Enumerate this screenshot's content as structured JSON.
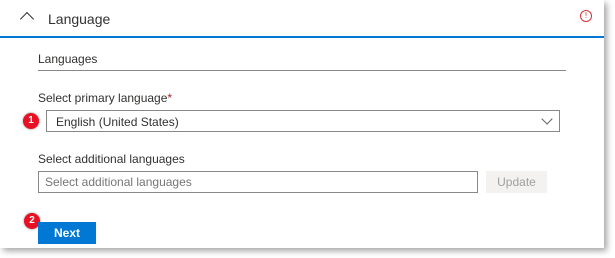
{
  "header": {
    "title": "Language",
    "collapse_icon": "chevron-up-icon",
    "info_icon": "info-icon",
    "info_glyph": "!"
  },
  "languages_section": {
    "title": "Languages",
    "primary": {
      "label": "Select primary language",
      "required_mark": "*",
      "value": "English (United States)"
    },
    "additional": {
      "label": "Select additional languages",
      "placeholder": "Select additional languages",
      "update_label": "Update"
    }
  },
  "footer": {
    "next_label": "Next"
  },
  "callouts": {
    "step1": "1",
    "step2": "2"
  },
  "colors": {
    "accent": "#0078d4",
    "badge": "#e81123",
    "required": "#a4262c",
    "disabled_text": "#a19f9d",
    "info": "#d13438"
  }
}
